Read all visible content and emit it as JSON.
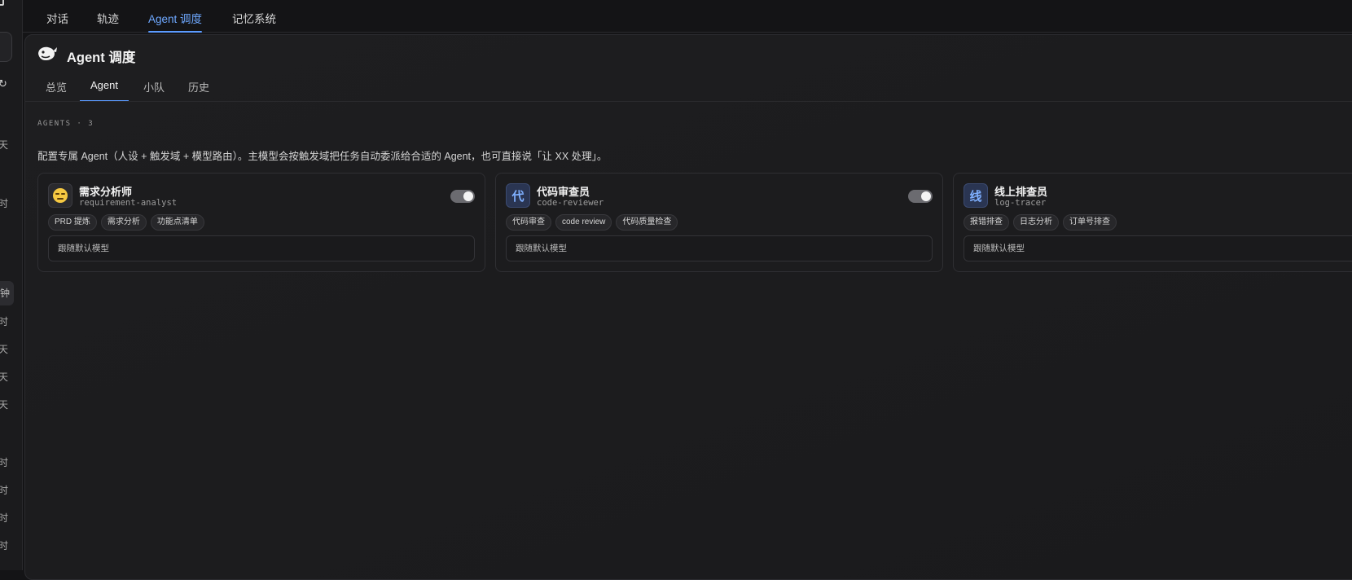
{
  "top_tabs": [
    {
      "label": "对话",
      "active": false
    },
    {
      "label": "轨迹",
      "active": false
    },
    {
      "label": "Agent 调度",
      "active": true
    },
    {
      "label": "记忆系统",
      "active": false
    }
  ],
  "rail": {
    "items": [
      "天",
      "时",
      "钟",
      "时",
      "天",
      "天",
      "天",
      "时",
      "时",
      "时",
      "时"
    ]
  },
  "header": {
    "title": "Agent 调度",
    "logo_icon": "whale-logo-icon"
  },
  "sub_tabs": [
    {
      "label": "总览",
      "active": false
    },
    {
      "label": "Agent",
      "active": true
    },
    {
      "label": "小队",
      "active": false
    },
    {
      "label": "历史",
      "active": false
    }
  ],
  "section": {
    "label": "AGENTS · 3",
    "description": "配置专属 Agent（人设 + 触发域 + 模型路由）。主模型会按触发域把任务自动委派给合适的 Agent，也可直接说「让 XX 处理」。"
  },
  "agents": [
    {
      "name": "需求分析师",
      "id": "requirement-analyst",
      "avatar": "",
      "avatar_icon": "expressionless-face-emoji-icon",
      "enabled": true,
      "tags": [
        "PRD 提炼",
        "需求分析",
        "功能点清单"
      ],
      "model": "跟随默认模型"
    },
    {
      "name": "代码审查员",
      "id": "code-reviewer",
      "avatar": "代",
      "enabled": true,
      "tags": [
        "代码审查",
        "code review",
        "代码质量检查"
      ],
      "model": "跟随默认模型"
    },
    {
      "name": "线上排查员",
      "id": "log-tracer",
      "avatar": "线",
      "enabled": true,
      "tags": [
        "报错排查",
        "日志分析",
        "订单号排查"
      ],
      "model": "跟随默认模型"
    }
  ],
  "colors": {
    "accent": "#5b9bff",
    "background": "#141416",
    "panel": "#1e1e20",
    "card": "#1c1c1e"
  }
}
